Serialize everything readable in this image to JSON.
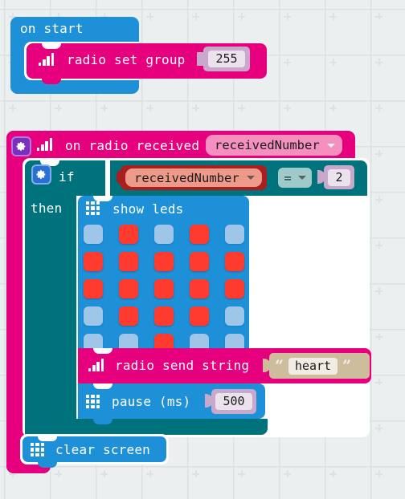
{
  "workspace": {
    "background_color": "#ECEFF0",
    "grid_color": "#DDE2E3",
    "grid_spacing": 57
  },
  "palette": {
    "event_blue": "#1E90D8",
    "radio_pink": "#E6007E",
    "logic_teal": "#00727B",
    "variable_red": "#A91F1F",
    "number_shadow": "#C8A8CB",
    "number_field": "#EBE2EE",
    "string_shadow": "#CDBD9D",
    "led_on": "#FF3B30",
    "led_off": "#9DC6E8"
  },
  "blocks": {
    "on_start": {
      "label": "on start",
      "icon": "none"
    },
    "radio_set_group": {
      "icon": "radio-signal-icon",
      "label": "radio set group",
      "value": "255"
    },
    "on_radio_received": {
      "gear_icon": "gear-icon",
      "icon": "radio-signal-icon",
      "label": "on radio received",
      "parameter": "receivedNumber",
      "dropdown_arrow": "chevron-down-icon"
    },
    "if_then": {
      "gear_icon": "gear-icon",
      "if_label": "if",
      "then_label": "then"
    },
    "comparison": {
      "left_variable": "receivedNumber",
      "operator": "=",
      "right_value": "2",
      "dropdown_arrow": "chevron-down-icon"
    },
    "show_leds": {
      "icon": "led-grid-icon",
      "label": "show leds",
      "pattern": [
        [
          0,
          1,
          0,
          1,
          0
        ],
        [
          1,
          1,
          1,
          1,
          1
        ],
        [
          1,
          1,
          1,
          1,
          1
        ],
        [
          0,
          1,
          1,
          1,
          0
        ],
        [
          0,
          0,
          1,
          0,
          0
        ]
      ]
    },
    "radio_send_string": {
      "icon": "radio-signal-icon",
      "label": "radio send string",
      "open_quote": "“",
      "close_quote": "”",
      "value": "heart"
    },
    "pause": {
      "icon": "led-grid-icon",
      "label": "pause (ms)",
      "value": "500"
    },
    "clear_screen": {
      "icon": "led-grid-icon",
      "label": "clear screen"
    }
  }
}
